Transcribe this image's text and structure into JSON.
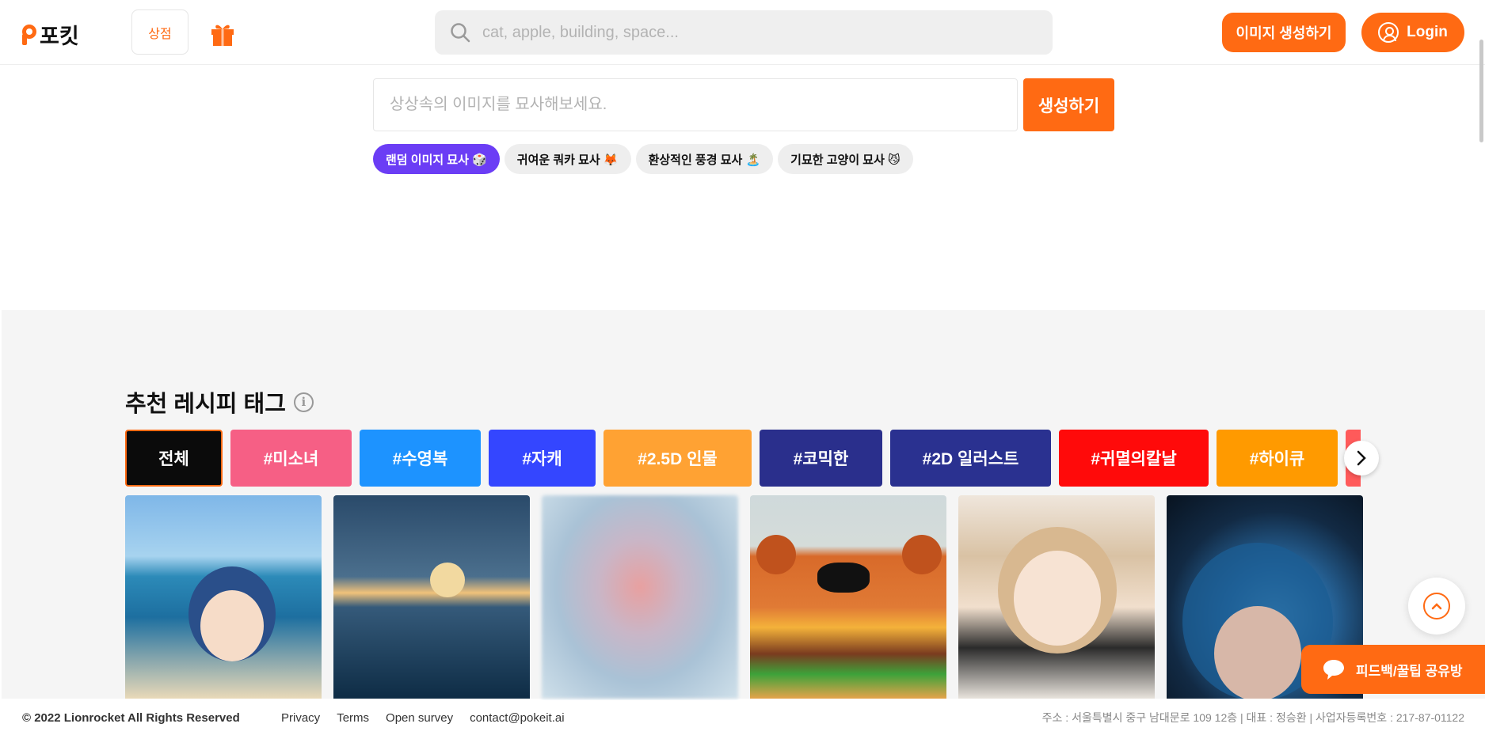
{
  "header": {
    "logo_text": "포킷",
    "store_label": "상점",
    "search_placeholder": "cat, apple, building, space...",
    "generate_label": "이미지 생성하기",
    "login_label": "Login"
  },
  "prompt": {
    "placeholder": "상상속의 이미지를 묘사해보세요.",
    "submit_label": "생성하기",
    "chips": [
      {
        "label": "랜덤 이미지 묘사 🎲"
      },
      {
        "label": "귀여운 쿼카 묘사 🦊"
      },
      {
        "label": "환상적인 풍경 묘사 🏝️"
      },
      {
        "label": "기묘한 고양이 묘사 😼"
      }
    ]
  },
  "recipe": {
    "title": "추천 레시피 태그",
    "tags": [
      {
        "label": "전체",
        "color": "#0b0b0b"
      },
      {
        "label": "#미소녀",
        "color": "#f65f85"
      },
      {
        "label": "#수영복",
        "color": "#1d93ff"
      },
      {
        "label": "#자캐",
        "color": "#3446ff"
      },
      {
        "label": "#2.5D 인물",
        "color": "#ffa233"
      },
      {
        "label": "#코믹한",
        "color": "#2a2f8c"
      },
      {
        "label": "#2D 일러스트",
        "color": "#2a3190"
      },
      {
        "label": "#귀멸의칼날",
        "color": "#ff0a0a"
      },
      {
        "label": "#하이큐",
        "color": "#ff9a00"
      }
    ]
  },
  "floating": {
    "feedback_label": "피드백/꿀팁 공유방"
  },
  "footer": {
    "copyright": "© 2022 Lionrocket All Rights Reserved",
    "links": [
      "Privacy",
      "Terms",
      "Open survey",
      "contact@pokeit.ai"
    ],
    "address": "주소 : 서울특별시 중구 남대문로 109 12층 | 대표 : 정승환 | 사업자등록번호 : 217-87-01122"
  },
  "colors": {
    "accent": "#ff6a13",
    "chip_active": "#6b3df5"
  }
}
